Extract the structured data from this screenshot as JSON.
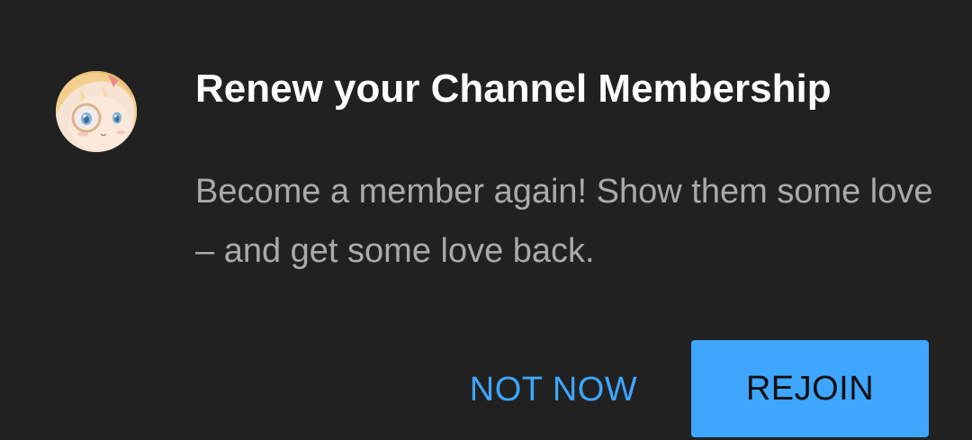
{
  "dialog": {
    "title": "Renew your Channel Membership",
    "message": "Become a member again! Show them some love – and get some love back.",
    "buttons": {
      "not_now": "NOT NOW",
      "rejoin": "REJOIN"
    }
  },
  "colors": {
    "background": "#212121",
    "title": "#ffffff",
    "message": "#aaaaaa",
    "accent": "#3ea6ff",
    "button_text": "#0f0f0f"
  },
  "icons": {
    "avatar": "channel-avatar-anime-character"
  }
}
